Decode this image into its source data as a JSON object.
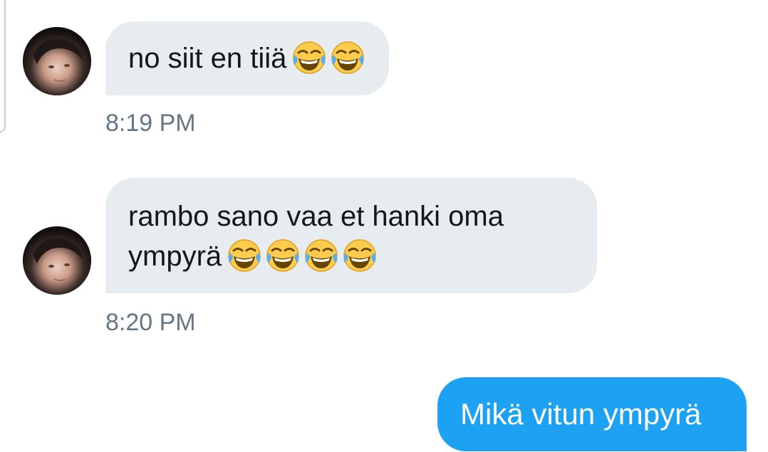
{
  "conversation": {
    "messages": [
      {
        "sender": "incoming",
        "lines": [
          "no siit en tiiä"
        ],
        "emoji": [
          "face-with-tears-of-joy-icon",
          "face-with-tears-of-joy-icon"
        ],
        "timestamp": "8:19 PM"
      },
      {
        "sender": "incoming",
        "lines": [
          "rambo sano vaa et hanki oma",
          "ympyrä"
        ],
        "emoji": [
          "face-with-tears-of-joy-icon",
          "face-with-tears-of-joy-icon",
          "face-with-tears-of-joy-icon",
          "face-with-tears-of-joy-icon"
        ],
        "timestamp": "8:20 PM"
      },
      {
        "sender": "outgoing",
        "lines": [
          "Mikä vitun ympyrä"
        ]
      }
    ]
  },
  "colors": {
    "incoming_bubble": "#e6ecf0",
    "outgoing_bubble": "#1da1f2",
    "timestamp_text": "#657786",
    "message_text": "#14171a"
  }
}
